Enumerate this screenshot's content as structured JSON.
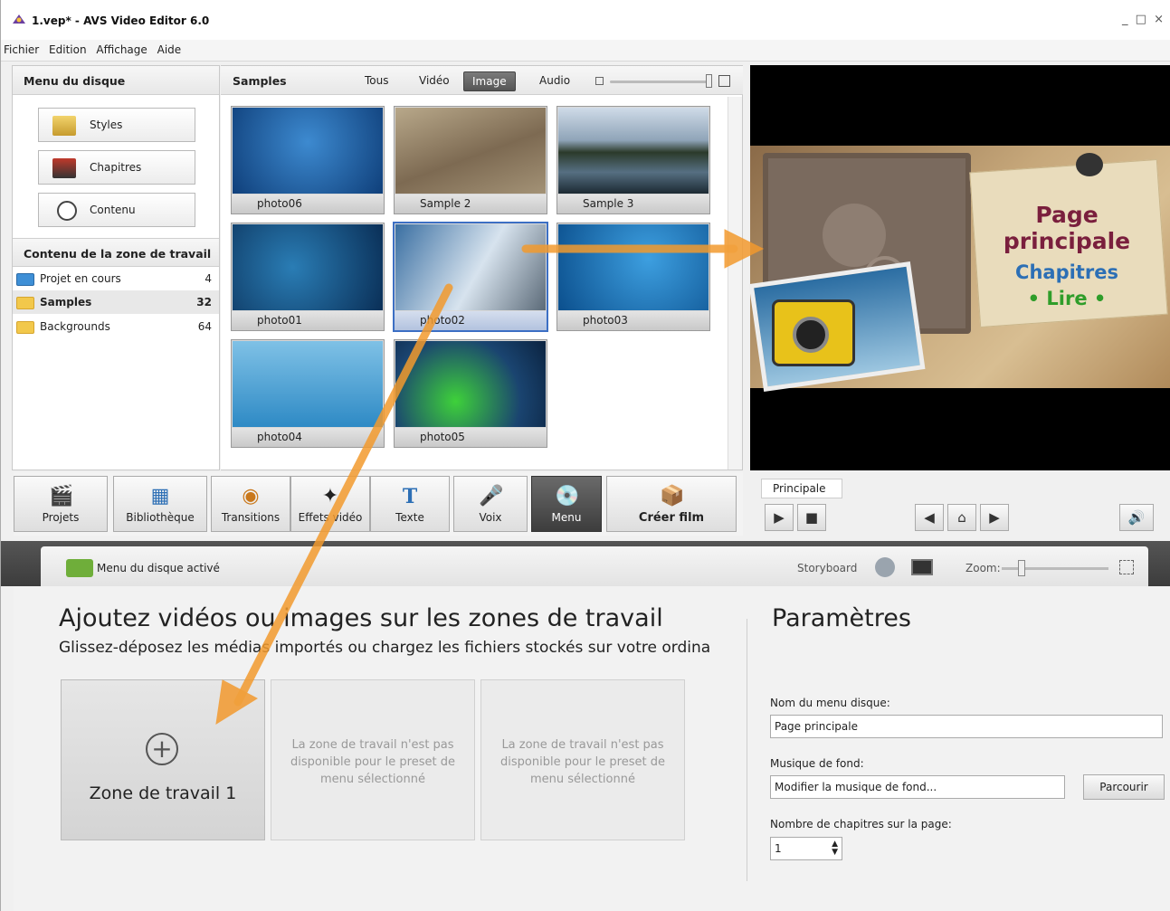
{
  "window": {
    "title": "1.vep* - AVS Video Editor 6.0",
    "controls": "_ □ ×"
  },
  "menu": [
    "Fichier",
    "Edition",
    "Affichage",
    "Aide"
  ],
  "disc_menu": {
    "header": "Menu du disque",
    "buttons": [
      "Styles",
      "Chapitres",
      "Contenu"
    ],
    "content_header": "Contenu de la zone de travail",
    "tree": [
      {
        "name": "Projet en cours",
        "count": "4"
      },
      {
        "name": "Samples",
        "count": "32"
      },
      {
        "name": "Backgrounds",
        "count": "64"
      }
    ]
  },
  "samples": {
    "header": "Samples",
    "filters": [
      "Tous",
      "Vidéo",
      "Image",
      "Audio"
    ],
    "active_filter": "Image",
    "items": [
      "photo06",
      "Sample 2",
      "Sample 3",
      "photo01",
      "photo02",
      "photo03",
      "photo04",
      "photo05"
    ],
    "selected": "photo02"
  },
  "preview": {
    "title1": "Page",
    "title2": "principale",
    "chapters": "Chapitres",
    "play": "• Lire •"
  },
  "toolbar": [
    "Projets",
    "Bibliothèque",
    "Transitions",
    "Effets vidéo",
    "Texte",
    "Voix",
    "Menu",
    "Créer film"
  ],
  "player": {
    "page_tab": "Principale"
  },
  "storyboard": {
    "status": "Menu du disque activé",
    "storyboard_label": "Storyboard",
    "zoom_label": "Zoom:"
  },
  "workspace": {
    "title": "Ajoutez vidéos ou images sur les zones de travail",
    "subtitle": "Glissez-déposez les médias importés ou chargez les fichiers stockés sur votre ordinateur",
    "zone1": "Zone de travail 1",
    "zone_unavailable": "La zone de travail  n'est pas disponible pour le preset de menu sélectionné"
  },
  "params": {
    "title": "Paramètres",
    "menu_name_label": "Nom du menu disque:",
    "menu_name_value": "Page principale",
    "music_label": "Musique de fond:",
    "music_value": "Modifier la musique de fond...",
    "browse": "Parcourir",
    "chapters_label": "Nombre de chapitres sur la page:",
    "chapters_value": "1"
  },
  "colors": {
    "accent_arrow": "#f29a2e",
    "selection": "#3c6fc4"
  }
}
